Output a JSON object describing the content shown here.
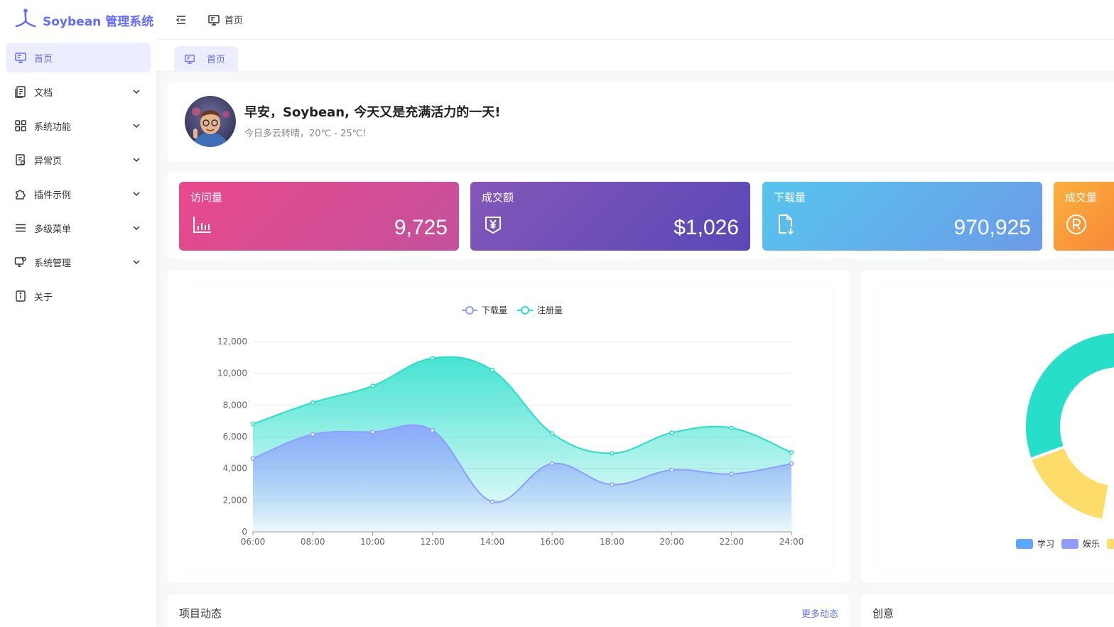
{
  "app": {
    "title": "Soybean 管理系统"
  },
  "sidebar": {
    "items": [
      {
        "label": "首页",
        "icon": "monitor-icon",
        "active": true
      },
      {
        "label": "文档",
        "icon": "document-icon",
        "expandable": true
      },
      {
        "label": "系统功能",
        "icon": "grid-icon",
        "expandable": true
      },
      {
        "label": "异常页",
        "icon": "error-page-icon",
        "expandable": true
      },
      {
        "label": "插件示例",
        "icon": "puzzle-icon",
        "expandable": true
      },
      {
        "label": "多级菜单",
        "icon": "menu-lines-icon",
        "expandable": true
      },
      {
        "label": "系统管理",
        "icon": "settings-monitor-icon",
        "expandable": true
      },
      {
        "label": "关于",
        "icon": "info-icon"
      }
    ]
  },
  "header": {
    "breadcrumb": "首页"
  },
  "tabs": [
    {
      "label": "首页"
    }
  ],
  "welcome": {
    "greeting": "早安，Soybean, 今天又是充满活力的一天!",
    "weather": "今日多云转晴，20℃ - 25℃!"
  },
  "stats": [
    {
      "title": "访问量",
      "value": "9,725",
      "icon": "bar-chart-icon"
    },
    {
      "title": "成交额",
      "value": "$1,026",
      "icon": "yen-bag-icon"
    },
    {
      "title": "下载量",
      "value": "970,925",
      "icon": "file-download-icon"
    },
    {
      "title": "成交量",
      "value": "",
      "icon": "registered-icon"
    }
  ],
  "chart_data": [
    {
      "type": "area",
      "x": [
        "06:00",
        "08:00",
        "10:00",
        "12:00",
        "14:00",
        "16:00",
        "18:00",
        "20:00",
        "22:00",
        "24:00"
      ],
      "series": [
        {
          "name": "下载量",
          "color": "#8e9dff",
          "values": [
            4623,
            6145,
            6300,
            6400,
            1900,
            4300,
            2980,
            3900,
            3650,
            4300
          ]
        },
        {
          "name": "注册量",
          "color": "#26deca",
          "values": [
            6800,
            8150,
            9200,
            10950,
            10200,
            6200,
            4950,
            6250,
            6550,
            5000
          ]
        }
      ],
      "ylim": [
        0,
        12000
      ],
      "yticks": [
        "0",
        "2,000",
        "4,000",
        "6,000",
        "8,000",
        "10,000",
        "12,000"
      ],
      "legend": "top-center",
      "grid": true
    },
    {
      "type": "pie",
      "variant": "donut",
      "legend": [
        {
          "name": "学习",
          "color": "#5da8ff"
        },
        {
          "name": "娱乐",
          "color": "#8e9dff"
        },
        {
          "name": "",
          "color": "#fedc69"
        }
      ],
      "visible_segments": [
        {
          "color": "#26deca"
        },
        {
          "color": "#fedc69"
        },
        {
          "color": "#5da8ff"
        }
      ]
    }
  ],
  "bottom": {
    "project_title": "项目动态",
    "project_link": "更多动态",
    "creative_title": "创意"
  },
  "colors": {
    "primary": "#646cff"
  }
}
